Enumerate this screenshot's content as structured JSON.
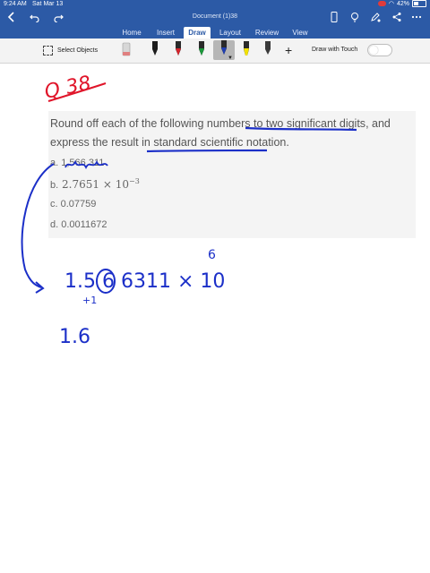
{
  "status_bar": {
    "time": "9:24 AM",
    "date": "Sat Mar 13",
    "battery": "42%"
  },
  "title_bar": {
    "document_title": "Document (1)38",
    "icons": [
      "back-icon",
      "undo-icon",
      "redo-icon",
      "phone-icon",
      "lightbulb-icon",
      "pen-edit-icon",
      "share-icon",
      "more-icon"
    ]
  },
  "tabs": [
    {
      "label": "Home",
      "active": false
    },
    {
      "label": "Insert",
      "active": false
    },
    {
      "label": "Draw",
      "active": true
    },
    {
      "label": "Layout",
      "active": false
    },
    {
      "label": "Review",
      "active": false
    },
    {
      "label": "View",
      "active": false
    }
  ],
  "ribbon": {
    "select_objects": "Select Objects",
    "draw_with_touch": "Draw with Touch",
    "draw_with_touch_on": false,
    "selected_tool": "blue-pen",
    "tools": [
      {
        "name": "eraser",
        "color": "#d7d7d7"
      },
      {
        "name": "pen-black",
        "color": "#1c1c1c"
      },
      {
        "name": "pen-red",
        "color": "#d8242c"
      },
      {
        "name": "pen-green",
        "color": "#1a9a3a"
      },
      {
        "name": "pen-blue",
        "color": "#1f3fb5"
      },
      {
        "name": "highlighter-yellow",
        "color": "#f2e200"
      },
      {
        "name": "highlighter-gray",
        "color": "#3a3a3a"
      }
    ]
  },
  "document": {
    "question_parts": {
      "p1": "Round off each of the following numbers ",
      "p2": "to two significant digits",
      "p3": ", and express the result in ",
      "p4": "standard scientific notation",
      "p5": "."
    },
    "options": [
      {
        "label": "a.",
        "value": "1,566,311"
      },
      {
        "label": "b.",
        "mantissa": "2.7651",
        "times": "×",
        "base": "10",
        "exponent": "−3"
      },
      {
        "label": "c.",
        "value": "0.07759"
      },
      {
        "label": "d.",
        "value": "0.0011672"
      }
    ]
  },
  "handwriting": {
    "question_label": "Q 38",
    "step1": "1.5 6 6311 × 10",
    "step1_exponent": "6",
    "step1_digit_below": "+1",
    "step2": "1.6"
  },
  "colors": {
    "accent": "#2c5aa6",
    "ink_blue": "#1b2fc8",
    "ink_red": "#e0152a"
  }
}
